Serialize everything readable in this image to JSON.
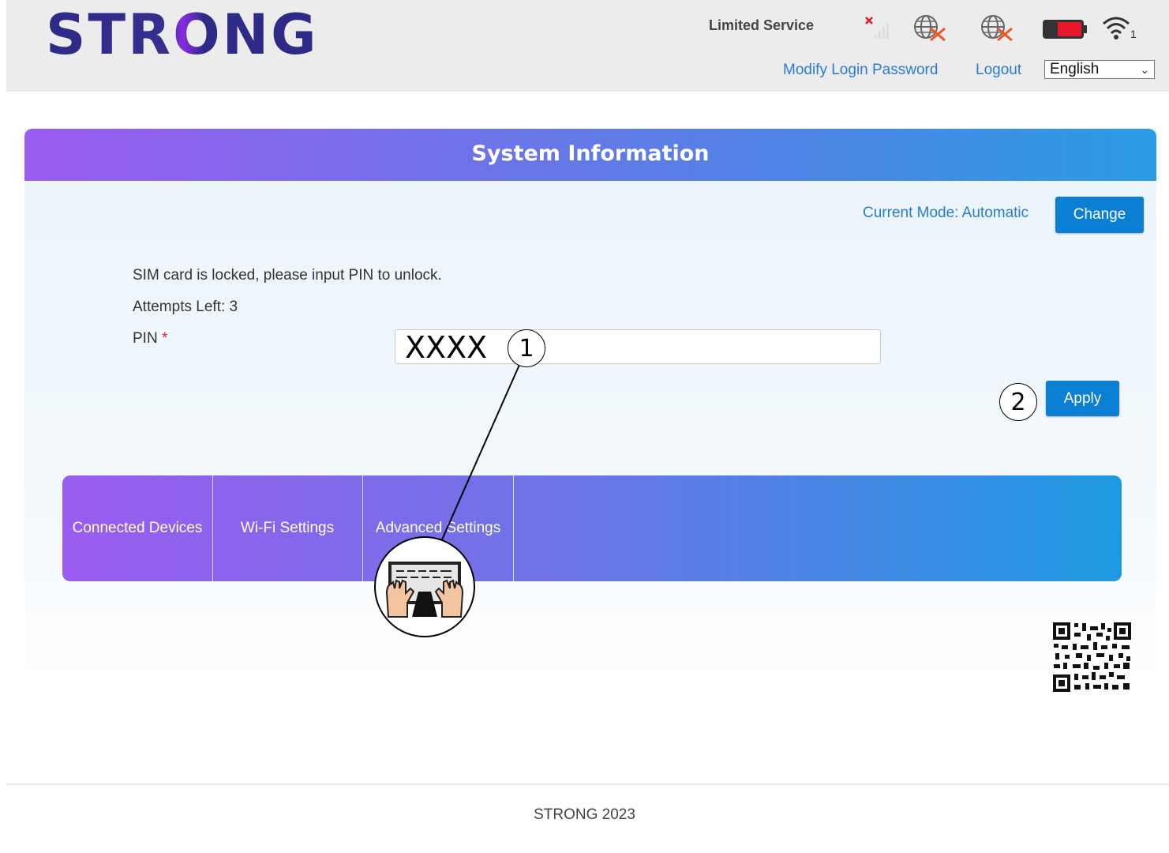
{
  "brand": {
    "logo": "STRONG"
  },
  "header": {
    "status": "Limited Service",
    "wifi_clients": "1",
    "modify_password": "Modify Login Password",
    "logout": "Logout",
    "language": "English"
  },
  "panel": {
    "title": "System Information",
    "mode_label": "Current Mode: Automatic",
    "change_label": "Change",
    "sim_message": "SIM card is locked, please input PIN to unlock.",
    "attempts": "Attempts Left: 3",
    "pin_label": "PIN",
    "pin_required": "*",
    "pin_value": "XXXX",
    "apply_label": "Apply"
  },
  "callouts": {
    "step1": "1",
    "step2": "2"
  },
  "nav": {
    "items": [
      {
        "label": "Connected Devices"
      },
      {
        "label": "Wi-Fi Settings"
      },
      {
        "label": "Advanced Settings"
      }
    ]
  },
  "footer": {
    "copyright": "STRONG 2023"
  },
  "icons": [
    "signal-off-icon",
    "globe-disconnected-icon",
    "globe-disconnected-icon",
    "battery-icon",
    "wifi-icon",
    "keyboard-typing-icon",
    "qr-code-icon"
  ],
  "colors": {
    "accent": "#0a7fd3",
    "link": "#2a7bd0",
    "gradient_start": "#9b5cf0",
    "gradient_end": "#1e9ae3"
  }
}
